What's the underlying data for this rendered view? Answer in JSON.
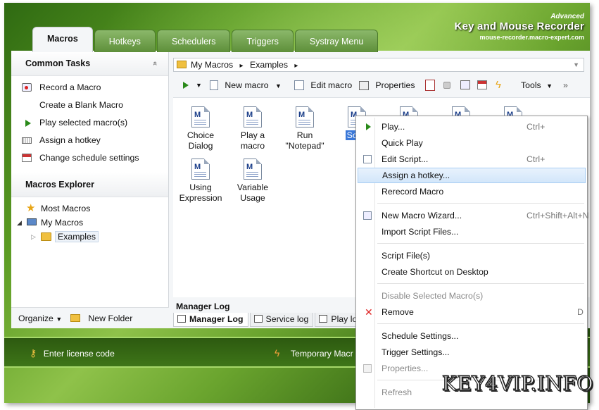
{
  "brand": {
    "advanced": "Advanced",
    "name": "Key and Mouse Recorder",
    "url": "mouse-recorder.macro-expert.com"
  },
  "tabs": [
    {
      "label": "Macros",
      "active": true
    },
    {
      "label": "Hotkeys"
    },
    {
      "label": "Schedulers"
    },
    {
      "label": "Triggers"
    },
    {
      "label": "Systray Menu"
    }
  ],
  "common_tasks": {
    "title": "Common Tasks",
    "collapse_glyph": "«",
    "items": [
      {
        "label": "Record a Macro",
        "icon": "record-icon"
      },
      {
        "label": "Create a Blank Macro",
        "icon": ""
      },
      {
        "label": "Play selected macro(s)",
        "icon": "play-icon"
      },
      {
        "label": "Assign a hotkey",
        "icon": "keyboard-icon"
      },
      {
        "label": "Change schedule settings",
        "icon": "calendar-icon"
      }
    ]
  },
  "explorer": {
    "title": "Macros Explorer",
    "tree": [
      {
        "label": "Most Macros",
        "icon": "star-icon"
      },
      {
        "label": "My Macros",
        "icon": "computer-icon"
      },
      {
        "label": "Examples",
        "icon": "folder-icon"
      }
    ],
    "organize": "Organize",
    "new_folder": "New Folder"
  },
  "address": {
    "root": "My Macros",
    "sep": "▸",
    "folder": "Examples"
  },
  "toolbar": {
    "new_macro": "New macro",
    "edit_macro": "Edit macro",
    "properties": "Properties",
    "tools": "Tools",
    "overflow": "»"
  },
  "files": [
    {
      "label": "Choice Dialog"
    },
    {
      "label": "Play a macro"
    },
    {
      "label": "Run \"Notepad\""
    },
    {
      "label": "Softp"
    },
    {
      "label": ""
    },
    {
      "label": ""
    },
    {
      "label": ""
    },
    {
      "label": "Using Expression"
    },
    {
      "label": "Variable Usage"
    }
  ],
  "log": {
    "title": "Manager Log",
    "tabs": [
      "Manager Log",
      "Service log",
      "Play log"
    ]
  },
  "statusbar": {
    "license": "Enter license code",
    "temporary": "Temporary Macr"
  },
  "context_menu": {
    "items": [
      {
        "label": "Play...",
        "shortcut": "Ctrl+",
        "icon": "play-icon"
      },
      {
        "label": "Quick Play",
        "shortcut": ""
      },
      {
        "label": "Edit Script...",
        "shortcut": "Ctrl+",
        "icon": "edit-icon"
      },
      {
        "label": "Assign a hotkey...",
        "shortcut": "",
        "highlighted": true
      },
      {
        "label": "Rerecord Macro",
        "shortcut": ""
      },
      {
        "label": "New Macro Wizard...",
        "shortcut": "Ctrl+Shift+Alt+N",
        "icon": "wizard-icon"
      },
      {
        "label": "Import Script Files...",
        "shortcut": ""
      },
      {
        "label": "Script File(s)",
        "shortcut": ""
      },
      {
        "label": "Create Shortcut on Desktop",
        "shortcut": ""
      },
      {
        "label": "Disable Selected Macro(s)",
        "shortcut": "",
        "disabled": true
      },
      {
        "label": "Remove",
        "shortcut": "D",
        "icon": "remove-icon"
      },
      {
        "label": "Schedule Settings...",
        "shortcut": ""
      },
      {
        "label": "Trigger Settings...",
        "shortcut": ""
      },
      {
        "label": "Properties...",
        "shortcut": "",
        "disabled": true,
        "icon": "properties-icon"
      },
      {
        "label": "Refresh",
        "shortcut": "",
        "disabled": true
      }
    ]
  },
  "watermark": "KEY4VIP.INFO",
  "colors": {
    "accent_green": "#5a9a22",
    "highlight": "#d2e6fa",
    "status_border": "#a6d86a"
  }
}
